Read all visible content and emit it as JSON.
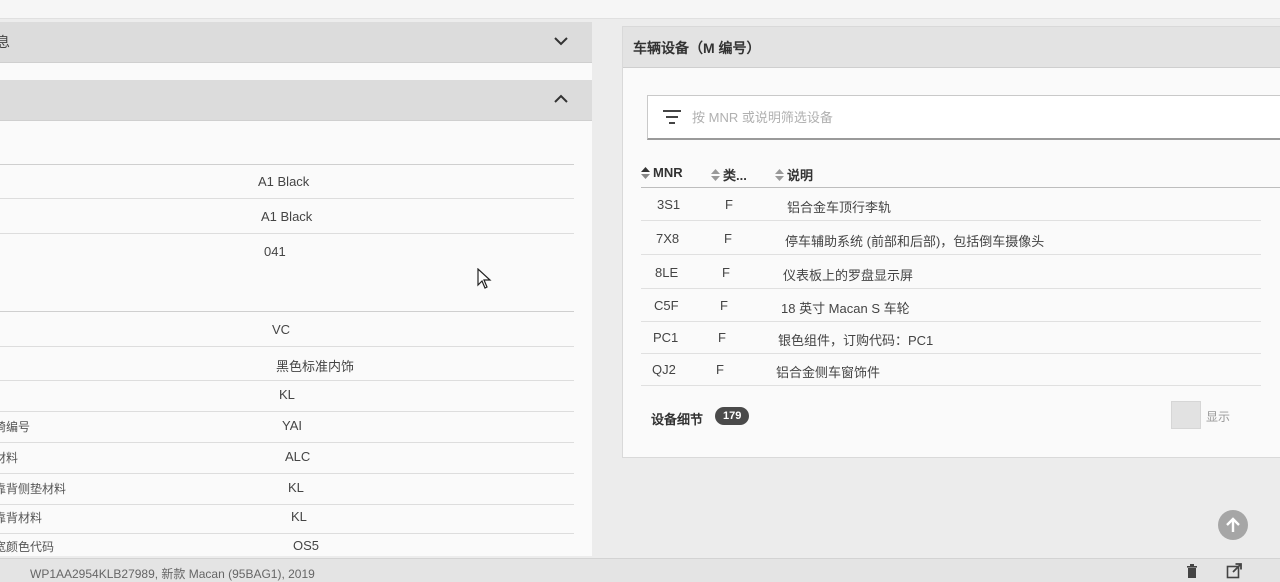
{
  "left": {
    "section1_title": "息",
    "rows_top": [
      {
        "label": "",
        "value": "A1 Black"
      },
      {
        "label": "",
        "value": "A1 Black"
      },
      {
        "label": "",
        "value": "041"
      },
      {
        "label": "",
        "value": ""
      }
    ],
    "rows_bottom": [
      {
        "label": "",
        "value": "VC"
      },
      {
        "label": "",
        "value": "黑色标准内饰"
      },
      {
        "label": "",
        "value": "KL"
      },
      {
        "label": "椅编号",
        "value": "YAI"
      },
      {
        "label": "材料",
        "value": "ALC"
      },
      {
        "label": "靠背侧垫材料",
        "value": "KL"
      },
      {
        "label": "靠背材料",
        "value": "KL"
      },
      {
        "label": "宽颜色代码",
        "value": "OS5"
      }
    ]
  },
  "right": {
    "title": "车辆设备（M 编号）",
    "filter_placeholder": "按 MNR 或说明筛选设备",
    "columns": {
      "mnr": "MNR",
      "type": "类...",
      "desc": "说明"
    },
    "rows": [
      {
        "mnr": "3S1",
        "type": "F",
        "desc": "铝合金车顶行李轨"
      },
      {
        "mnr": "7X8",
        "type": "F",
        "desc": "停车辅助系统 (前部和后部)，包括倒车摄像头"
      },
      {
        "mnr": "8LE",
        "type": "F",
        "desc": "仪表板上的罗盘显示屏"
      },
      {
        "mnr": "C5F",
        "type": "F",
        "desc": "18 英寸 Macan S 车轮"
      },
      {
        "mnr": "PC1",
        "type": "F",
        "desc": "银色组件，订购代码：PC1"
      },
      {
        "mnr": "QJ2",
        "type": "F",
        "desc": "铝合金侧车窗饰件"
      }
    ],
    "footer_label": "设备细节",
    "footer_count": "179",
    "toggle_label": "显示"
  },
  "bottom": {
    "vin_text": "WP1AA2954KLB27989, 新款 Macan (95BAG1), 2019"
  },
  "icons": {
    "chevron_down": "chevron-down-icon",
    "chevron_up": "chevron-up-icon",
    "filter": "filter-icon",
    "sort": "sort-icon",
    "trash": "trash-icon",
    "external": "external-link-icon",
    "arrow_up": "arrow-up-icon"
  }
}
